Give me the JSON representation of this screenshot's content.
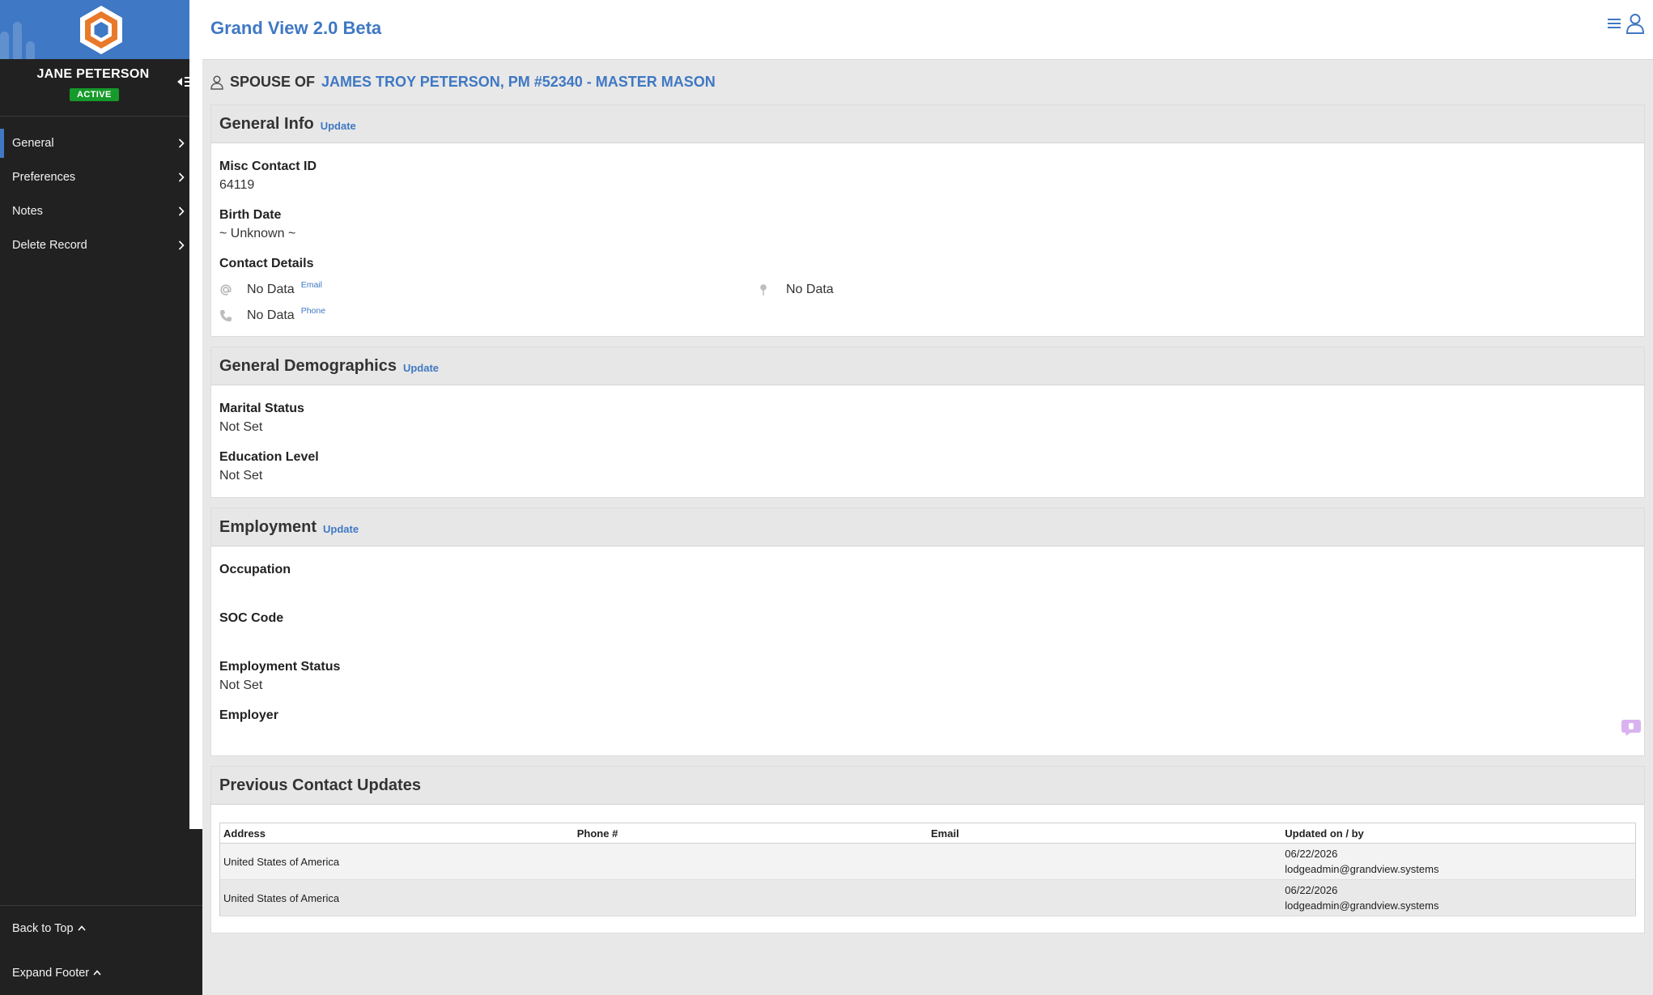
{
  "app": {
    "title": "Grand View 2.0 Beta"
  },
  "colors": {
    "brand_blue": "#3f78c4",
    "sidebar_bg": "#212121",
    "active_badge": "#169a2a",
    "logo_orange": "#e8792a"
  },
  "user": {
    "name": "JANE PETERSON",
    "status": "ACTIVE"
  },
  "sidebar": {
    "items": [
      {
        "label": "General",
        "icon": "chevron-right-icon",
        "active": true
      },
      {
        "label": "Preferences",
        "icon": "chevron-right-icon",
        "active": false
      },
      {
        "label": "Notes",
        "icon": "chevron-right-icon",
        "active": false
      },
      {
        "label": "Delete Record",
        "icon": "chevron-right-icon",
        "active": false
      }
    ],
    "footer": {
      "back_to_top": "Back to Top",
      "expand_footer": "Expand Footer"
    }
  },
  "context": {
    "prefix": "SPOUSE OF",
    "link": "JAMES TROY PETERSON, PM #52340 - MASTER MASON"
  },
  "general_info": {
    "title": "General Info",
    "update_label": "Update",
    "misc_contact_id_label": "Misc Contact ID",
    "misc_contact_id_value": "64119",
    "birth_date_label": "Birth Date",
    "birth_date_value": "~ Unknown ~",
    "contact_details_label": "Contact Details",
    "email_value": "No Data",
    "email_type": "Email",
    "phone_value": "No Data",
    "phone_type": "Phone",
    "address_value": "No Data"
  },
  "demographics": {
    "title": "General Demographics",
    "update_label": "Update",
    "marital_status_label": "Marital Status",
    "marital_status_value": "Not Set",
    "education_level_label": "Education Level",
    "education_level_value": "Not Set"
  },
  "employment": {
    "title": "Employment",
    "update_label": "Update",
    "occupation_label": "Occupation",
    "occupation_value": "",
    "soc_code_label": "SOC Code",
    "soc_code_value": "",
    "employment_status_label": "Employment Status",
    "employment_status_value": "Not Set",
    "employer_label": "Employer",
    "employer_value": ""
  },
  "previous_updates": {
    "title": "Previous Contact Updates",
    "columns": [
      "Address",
      "Phone #",
      "Email",
      "Updated on / by"
    ],
    "rows": [
      {
        "address": "United States of America",
        "phone": "",
        "email": "",
        "updated_on": "06/22/2026",
        "updated_by": "lodgeadmin@grandview.systems"
      },
      {
        "address": "United States of America",
        "phone": "",
        "email": "",
        "updated_on": "06/22/2026",
        "updated_by": "lodgeadmin@grandview.systems"
      }
    ]
  }
}
